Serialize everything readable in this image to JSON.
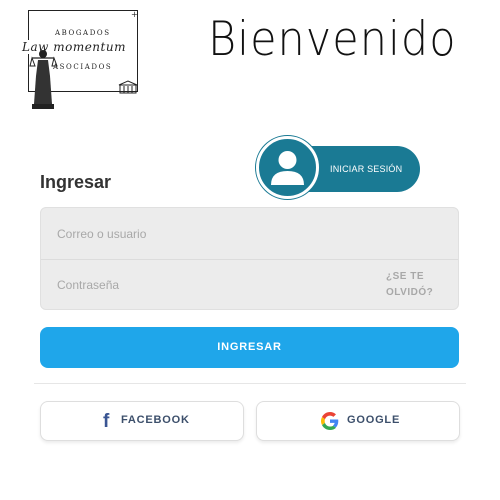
{
  "logo": {
    "top_text": "ABOGADOS",
    "script_text": "Law momentum",
    "bottom_text": "ASOCIADOS",
    "plus": "+"
  },
  "welcome": "Bienvenido",
  "login_pill": {
    "label": "INICIAR SESIÓN",
    "icon": "user-avatar-icon",
    "color": "#1a7a94"
  },
  "form": {
    "title": "Ingresar",
    "email_placeholder": "Correo o usuario",
    "password_placeholder": "Contraseña",
    "forgot_line1": "¿SE TE",
    "forgot_line2": "OLVIDÓ?",
    "submit_label": "INGRESAR",
    "submit_color": "#1fa6ea"
  },
  "social": {
    "facebook_label": "FACEBOOK",
    "facebook_icon": "facebook-icon",
    "google_label": "GOOGLE",
    "google_icon": "google-icon"
  }
}
